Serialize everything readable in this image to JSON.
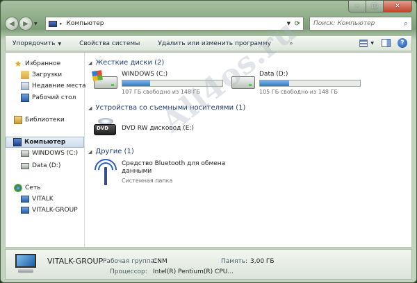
{
  "window": {
    "minimize_glyph": "‒",
    "maximize_glyph": "□",
    "close_glyph": "✕"
  },
  "navigation": {
    "back_glyph": "◀",
    "forward_glyph": "▶",
    "history_glyph": "▼"
  },
  "address": {
    "path": "Компьютер",
    "separator": "▸",
    "dropdown_glyph": "▼",
    "refresh_glyph": "⟳"
  },
  "search": {
    "placeholder": "Поиск: Компьютер"
  },
  "toolbar": {
    "organize": "Упорядочить",
    "organize_arrow": "▼",
    "system_properties": "Свойства системы",
    "uninstall": "Удалить или изменить программу",
    "more": "»",
    "views_arrow": "▼",
    "help": "?"
  },
  "sidebar": {
    "favorites": "Избранное",
    "downloads": "Загрузки",
    "recent": "Недавние места",
    "desktop": "Рабочий стол",
    "libraries": "Библиотеки",
    "computer": "Компьютер",
    "drive_c": "WINDOWS (C:)",
    "drive_d": "Data (D:)",
    "network": "Сеть",
    "host1": "VITALK",
    "host2": "VITALK-GROUP"
  },
  "main": {
    "hdd_group": "Жесткие диски (2)",
    "removable_group": "Устройства со съемными носителями (1)",
    "other_group": "Другие (1)",
    "chevron": "◢",
    "drive_c": {
      "name": "WINDOWS (C:)",
      "free": "107 ГБ свободно из 148 ГБ",
      "used_fraction": 0.28
    },
    "drive_d": {
      "name": "Data (D:)",
      "free": "105 ГБ свободно из 148 ГБ",
      "used_fraction": 0.29
    },
    "dvd": {
      "name": "DVD RW дисковод (E:)",
      "icon_text": "DVD"
    },
    "bluetooth": {
      "name": "Средство Bluetooth для обмена данными",
      "type": "Системная папка"
    }
  },
  "details": {
    "hostname": "VITALK-GROUP",
    "workgroup_label": "Рабочая группа:",
    "workgroup_value": "CNM",
    "memory_label": "Память:",
    "memory_value": "3,00 ГБ",
    "cpu_label": "Процессор:",
    "cpu_value": "Intel(R) Pentium(R) CPU..."
  },
  "watermark": "All4os.ru"
}
